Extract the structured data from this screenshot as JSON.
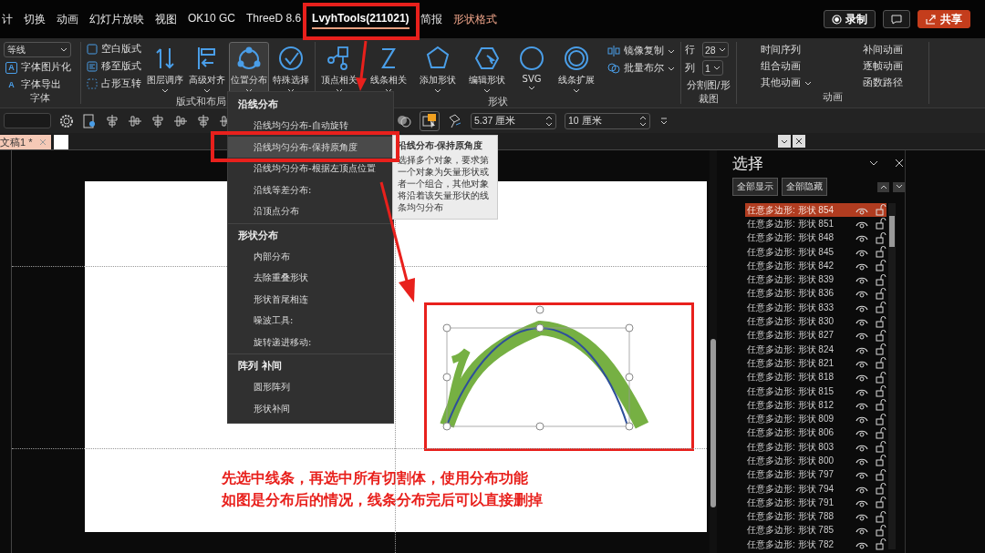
{
  "menu_bar": {
    "tabs": [
      {
        "label": "计",
        "selected": false,
        "kind": "normal"
      },
      {
        "label": "切换",
        "selected": false,
        "kind": "normal"
      },
      {
        "label": "动画",
        "selected": false,
        "kind": "normal"
      },
      {
        "label": "幻灯片放映",
        "selected": false,
        "kind": "normal"
      },
      {
        "label": "视图",
        "selected": false,
        "kind": "normal"
      },
      {
        "label": "OK10 GC",
        "selected": false,
        "kind": "normal"
      },
      {
        "label": "ThreeD 8.6",
        "selected": false,
        "kind": "normal"
      },
      {
        "label": "LvyhTools(211021)",
        "selected": true,
        "kind": "normal"
      },
      {
        "label": "简报",
        "selected": false,
        "kind": "normal"
      },
      {
        "label": "形状格式",
        "selected": false,
        "kind": "contextual"
      }
    ],
    "record": "录制",
    "share": "共享"
  },
  "ribbon": {
    "font_group": {
      "font_select": "等线",
      "buttons": [
        {
          "icon": "A",
          "label": "字体图片化",
          "kind": "boxed"
        },
        {
          "icon": "A",
          "label": "字体导出",
          "kind": "plain"
        }
      ],
      "label": "字体"
    },
    "layout_group": {
      "small_buttons": [
        "空白版式",
        "移至版式",
        "占形互转"
      ],
      "large_buttons": [
        {
          "label": "图层调序",
          "selected": false
        },
        {
          "label": "高级对齐",
          "selected": false
        },
        {
          "label": "位置分布",
          "selected": true
        },
        {
          "label": "特殊选择",
          "selected": false
        }
      ],
      "label": "版式和布局"
    },
    "shape_group": {
      "large_buttons": [
        "顶点相关",
        "线条相关",
        "添加形状",
        "编辑形状",
        "SVG",
        "线条扩展"
      ],
      "small_buttons": [
        "镜像复制",
        "批量布尔"
      ],
      "label": "形状"
    },
    "crop_group": {
      "row_label": "行",
      "row_value": "28",
      "column_label": "列",
      "column_value": "1",
      "button": "分割图/形",
      "label": "裁图"
    },
    "animation_group": {
      "buttons": [
        "时间序列",
        "补间动画",
        "组合动画",
        "逐帧动画",
        "其他动画",
        "函数路径"
      ],
      "label": "动画"
    }
  },
  "format_toolbar": {
    "height": "5.37 厘米",
    "width": "10 厘米"
  },
  "document_tab": {
    "label": "文稿1 *"
  },
  "dropdown": {
    "sections": [
      {
        "title": "沿线分布",
        "items": [
          {
            "label": "沿线均匀分布-自动旋转",
            "selected": false
          },
          {
            "label": "沿线均匀分布-保持原角度",
            "selected": true
          },
          {
            "label": "沿线均匀分布-根据左顶点位置",
            "selected": false
          },
          {
            "label": "沿线等差分布:",
            "selected": false
          },
          {
            "label": "沿顶点分布",
            "selected": false
          }
        ]
      },
      {
        "title": "形状分布",
        "items": [
          {
            "label": "内部分布",
            "selected": false
          },
          {
            "label": "去除重叠形状",
            "selected": false
          },
          {
            "label": "形状首尾相连",
            "selected": false
          },
          {
            "label": "噪波工具:",
            "selected": false
          },
          {
            "label": "旋转递进移动:",
            "selected": false
          }
        ]
      },
      {
        "title": "阵列 补间",
        "items": [
          {
            "label": "圆形阵列",
            "selected": false
          },
          {
            "label": "形状补间",
            "selected": false
          }
        ]
      }
    ]
  },
  "tooltip": {
    "title": "沿线分布-保持原角度",
    "text": "选择多个对象，要求第一个对象为矢量形状或者一个组合，其他对象将沿着该矢量形状的线条均匀分布"
  },
  "slide": {
    "caption_lines": [
      "先选中线条，再选中所有切割体，使用分布功能",
      "如图是分布后的情况，线条分布完后可以直接删掉"
    ]
  },
  "selection_pane": {
    "title": "选择",
    "show_all": "全部显示",
    "hide_all": "全部隐藏",
    "items": [
      {
        "name": "任意多边形: 形状 854",
        "selected": true
      },
      {
        "name": "任意多边形: 形状 851",
        "selected": false
      },
      {
        "name": "任意多边形: 形状 848",
        "selected": false
      },
      {
        "name": "任意多边形: 形状 845",
        "selected": false
      },
      {
        "name": "任意多边形: 形状 842",
        "selected": false
      },
      {
        "name": "任意多边形: 形状 839",
        "selected": false
      },
      {
        "name": "任意多边形: 形状 836",
        "selected": false
      },
      {
        "name": "任意多边形: 形状 833",
        "selected": false
      },
      {
        "name": "任意多边形: 形状 830",
        "selected": false
      },
      {
        "name": "任意多边形: 形状 827",
        "selected": false
      },
      {
        "name": "任意多边形: 形状 824",
        "selected": false
      },
      {
        "name": "任意多边形: 形状 821",
        "selected": false
      },
      {
        "name": "任意多边形: 形状 818",
        "selected": false
      },
      {
        "name": "任意多边形: 形状 815",
        "selected": false
      },
      {
        "name": "任意多边形: 形状 812",
        "selected": false
      },
      {
        "name": "任意多边形: 形状 809",
        "selected": false
      },
      {
        "name": "任意多边形: 形状 806",
        "selected": false
      },
      {
        "name": "任意多边形: 形状 803",
        "selected": false
      },
      {
        "name": "任意多边形: 形状 800",
        "selected": false
      },
      {
        "name": "任意多边形: 形状 797",
        "selected": false
      },
      {
        "name": "任意多边形: 形状 794",
        "selected": false
      },
      {
        "name": "任意多边形: 形状 791",
        "selected": false
      },
      {
        "name": "任意多边形: 形状 788",
        "selected": false
      },
      {
        "name": "任意多边形: 形状 785",
        "selected": false
      },
      {
        "name": "任意多边形: 形状 782",
        "selected": false
      }
    ]
  }
}
